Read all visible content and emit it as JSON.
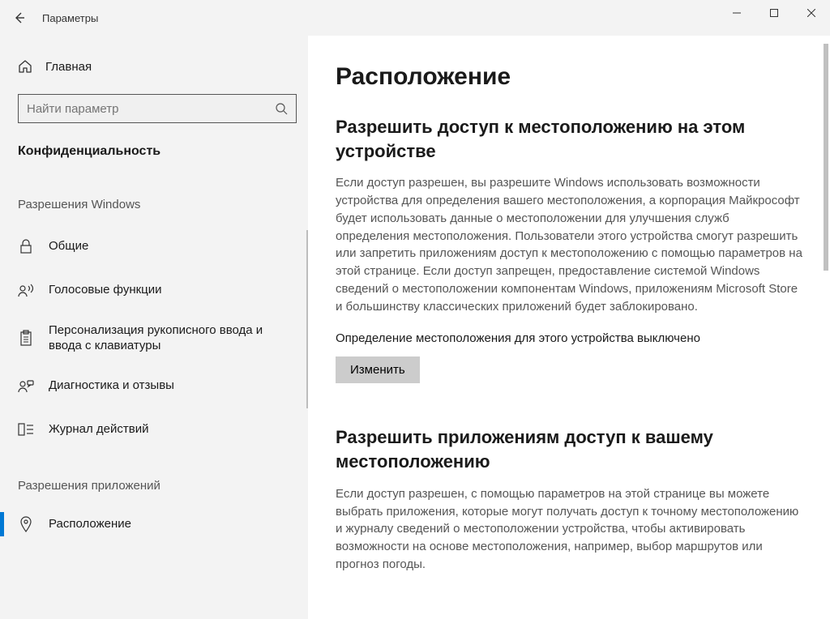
{
  "window": {
    "title": "Параметры"
  },
  "sidebar": {
    "home": "Главная",
    "search_placeholder": "Найти параметр",
    "category": "Конфиденциальность",
    "group_permissions_windows": "Разрешения Windows",
    "group_permissions_apps": "Разрешения приложений",
    "items_windows": [
      {
        "label": "Общие"
      },
      {
        "label": "Голосовые функции"
      },
      {
        "label": "Персонализация рукописного ввода и ввода с клавиатуры"
      },
      {
        "label": "Диагностика и отзывы"
      },
      {
        "label": "Журнал действий"
      }
    ],
    "items_apps": [
      {
        "label": "Расположение"
      }
    ]
  },
  "content": {
    "title": "Расположение",
    "section1": {
      "heading": "Разрешить доступ к местоположению на этом устройстве",
      "body": "Если доступ разрешен, вы разрешите Windows использовать возможности устройства для определения вашего местоположения, а корпорация Майкрософт будет использовать данные о местоположении для улучшения служб определения местоположения. Пользователи этого устройства смогут разрешить или запретить приложениям доступ к местоположению с помощью параметров на этой странице. Если доступ запрещен, предоставление системой Windows сведений о местоположении компонентам Windows, приложениям Microsoft Store и большинству классических приложений будет заблокировано.",
      "status": "Определение местоположения для этого устройства выключено",
      "change_btn": "Изменить"
    },
    "section2": {
      "heading": "Разрешить приложениям доступ к вашему местоположению",
      "body": "Если доступ разрешен, с помощью параметров на этой странице вы можете выбрать приложения, которые могут получать доступ к точному местоположению и журналу сведений о местоположении устройства, чтобы активировать возможности на основе местоположения, например, выбор маршрутов или прогноз погоды."
    }
  }
}
